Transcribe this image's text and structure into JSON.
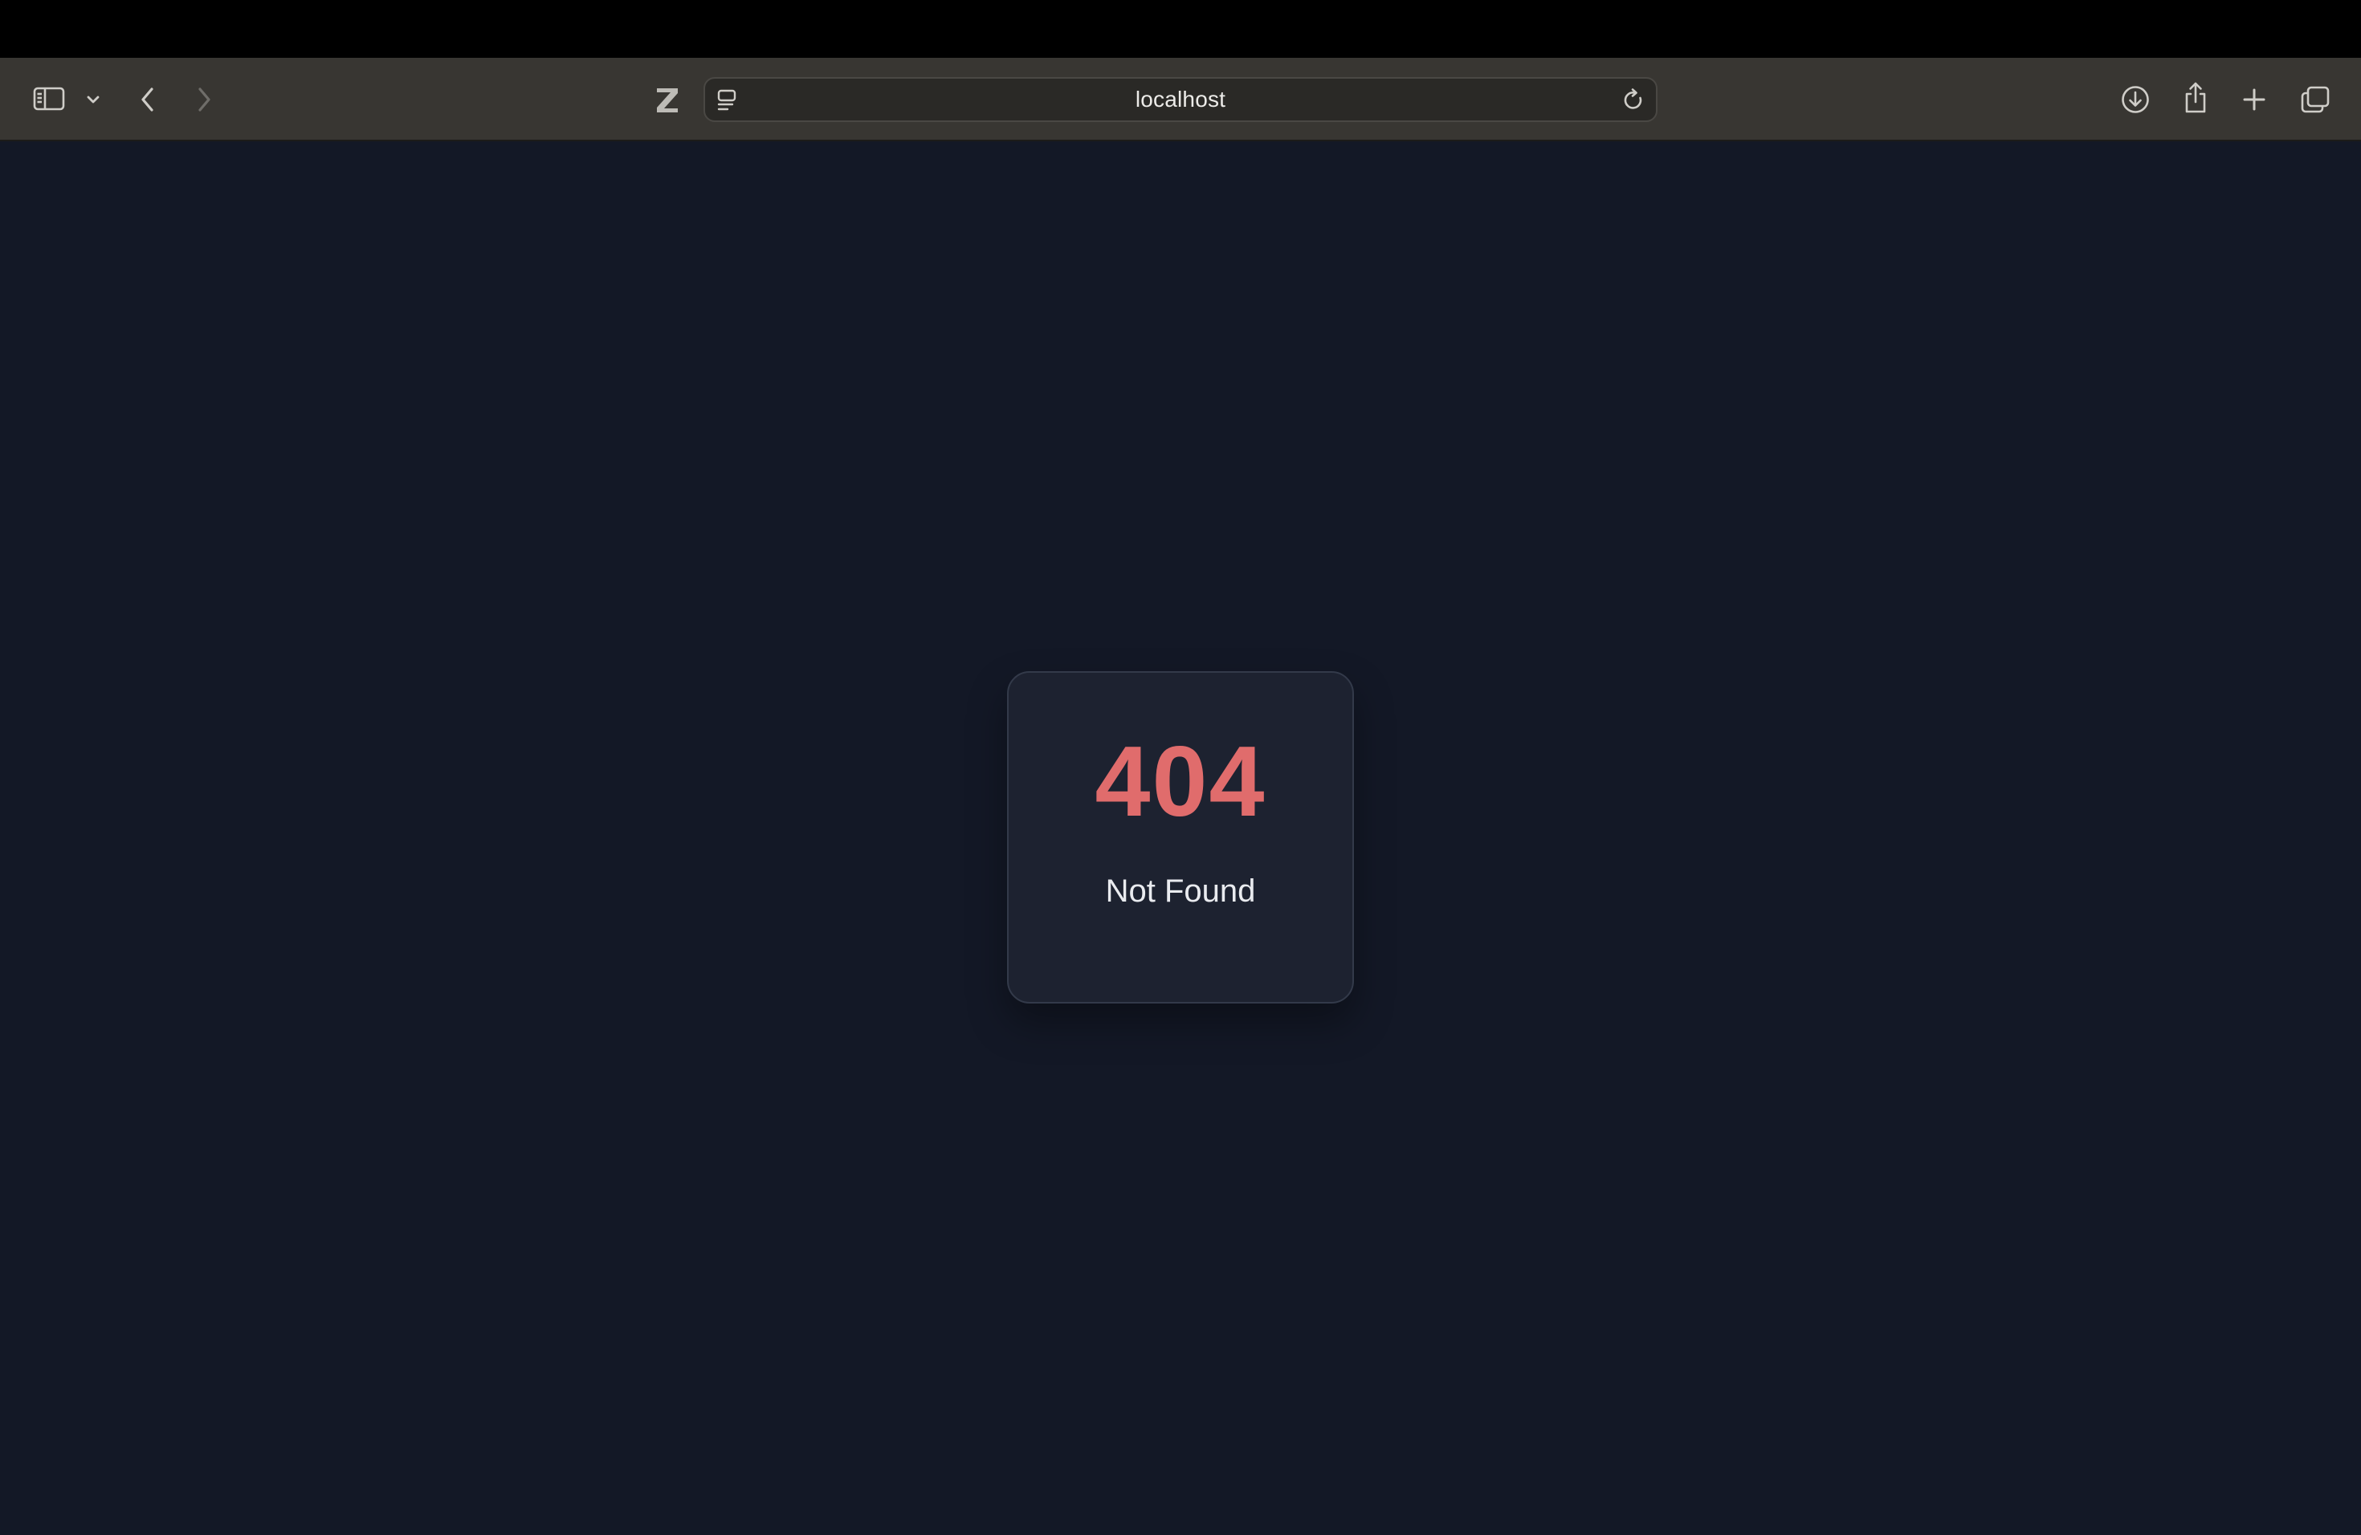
{
  "browser": {
    "address_bar": {
      "url": "localhost"
    },
    "icons": {
      "sidebar": "sidebar-icon",
      "sidebar_menu": "chevron-down-icon",
      "back": "chevron-left-icon",
      "forward": "chevron-right-icon",
      "extension": "zotero-z-icon",
      "page_settings": "page-menu-icon",
      "reload": "reload-icon",
      "downloads": "download-icon",
      "share": "share-icon",
      "new_tab": "plus-icon",
      "tab_overview": "tabs-icon"
    }
  },
  "page": {
    "error_code": "404",
    "error_message": "Not Found"
  },
  "colors": {
    "background": "#131826",
    "card": "#1d2230",
    "error_code": "#e06c6c"
  }
}
